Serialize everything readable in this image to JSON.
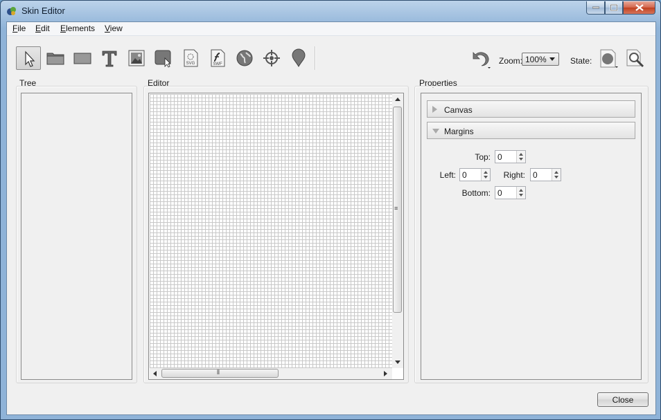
{
  "window": {
    "title": "Skin Editor"
  },
  "menu": [
    {
      "accel": "F",
      "rest": "ile"
    },
    {
      "accel": "E",
      "rest": "dit"
    },
    {
      "accel": "E",
      "rest": "lements"
    },
    {
      "accel": "V",
      "rest": "iew"
    }
  ],
  "toolbar": {
    "tools": [
      "pointer-icon",
      "folder-icon",
      "rectangle-icon",
      "text-icon",
      "image-icon",
      "button-icon",
      "svg-icon",
      "swf-icon",
      "globe-icon",
      "crosshair-icon",
      "pin-icon"
    ],
    "zoom_label": "Zoom:",
    "zoom_value": "100%",
    "state_label": "State:"
  },
  "panels": {
    "tree_label": "Tree",
    "editor_label": "Editor",
    "properties_label": "Properties"
  },
  "properties": {
    "sections": [
      {
        "label": "Canvas",
        "expanded": false
      },
      {
        "label": "Margins",
        "expanded": true
      }
    ],
    "margins": {
      "top_label": "Top:",
      "top_value": "0",
      "left_label": "Left:",
      "left_value": "0",
      "right_label": "Right:",
      "right_value": "0",
      "bottom_label": "Bottom:",
      "bottom_value": "0"
    }
  },
  "footer": {
    "close_label": "Close"
  },
  "colors": {
    "title_bar": "#8fb3d8",
    "client_bg": "#f0f0f0",
    "close_button": "#c0401f"
  }
}
